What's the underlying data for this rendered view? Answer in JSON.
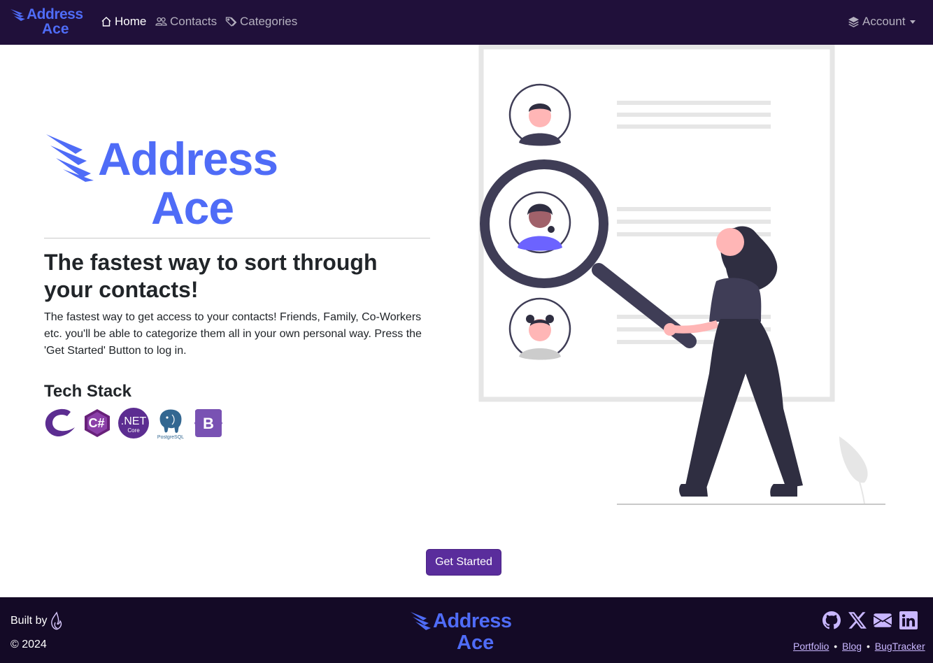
{
  "colors": {
    "navbar_bg": "#20103a",
    "footer_bg": "#140a26",
    "brand_blue": "#4f6cf7",
    "button_purple": "#5a2d9c",
    "link_lavender": "#c9b7ff"
  },
  "navbar": {
    "logo_line1": "Address",
    "logo_line2": "Ace",
    "links": [
      {
        "label": "Home",
        "icon": "house-icon",
        "active": true
      },
      {
        "label": "Contacts",
        "icon": "people-icon",
        "active": false
      },
      {
        "label": "Categories",
        "icon": "tags-icon",
        "active": false
      }
    ],
    "account_label": "Account",
    "account_icon": "stack-layers-icon"
  },
  "hero": {
    "logo_line1": "Address",
    "logo_line2": "Ace",
    "headline": "The fastest way to sort through your contacts!",
    "lead": "The fastest way to get access to your contacts! Friends, Family, Co-Workers etc. you'll be able to categorize them all in your own personal way. Press the 'Get Started' Button to log in.",
    "tech_stack_title": "Tech Stack",
    "tech_stack_icons": [
      "blazor-icon",
      "csharp-icon",
      "dotnet-core-icon",
      "postgresql-icon",
      "bootstrap-icon"
    ],
    "dotnet_text": ".NET",
    "dotnet_sub": "Core",
    "postgres_text": "PostgreSQL",
    "bootstrap_text": "B",
    "csharp_text": "C#"
  },
  "cta": {
    "label": "Get Started"
  },
  "footer": {
    "built_by": "Built by",
    "copyright": "© 2024",
    "logo_line1": "Address",
    "logo_line2": "Ace",
    "social_icons": [
      "github-icon",
      "x-icon",
      "mail-icon",
      "linkedin-icon"
    ],
    "links": [
      "Portfolio",
      "Blog",
      "BugTracker"
    ],
    "separator": "•"
  }
}
